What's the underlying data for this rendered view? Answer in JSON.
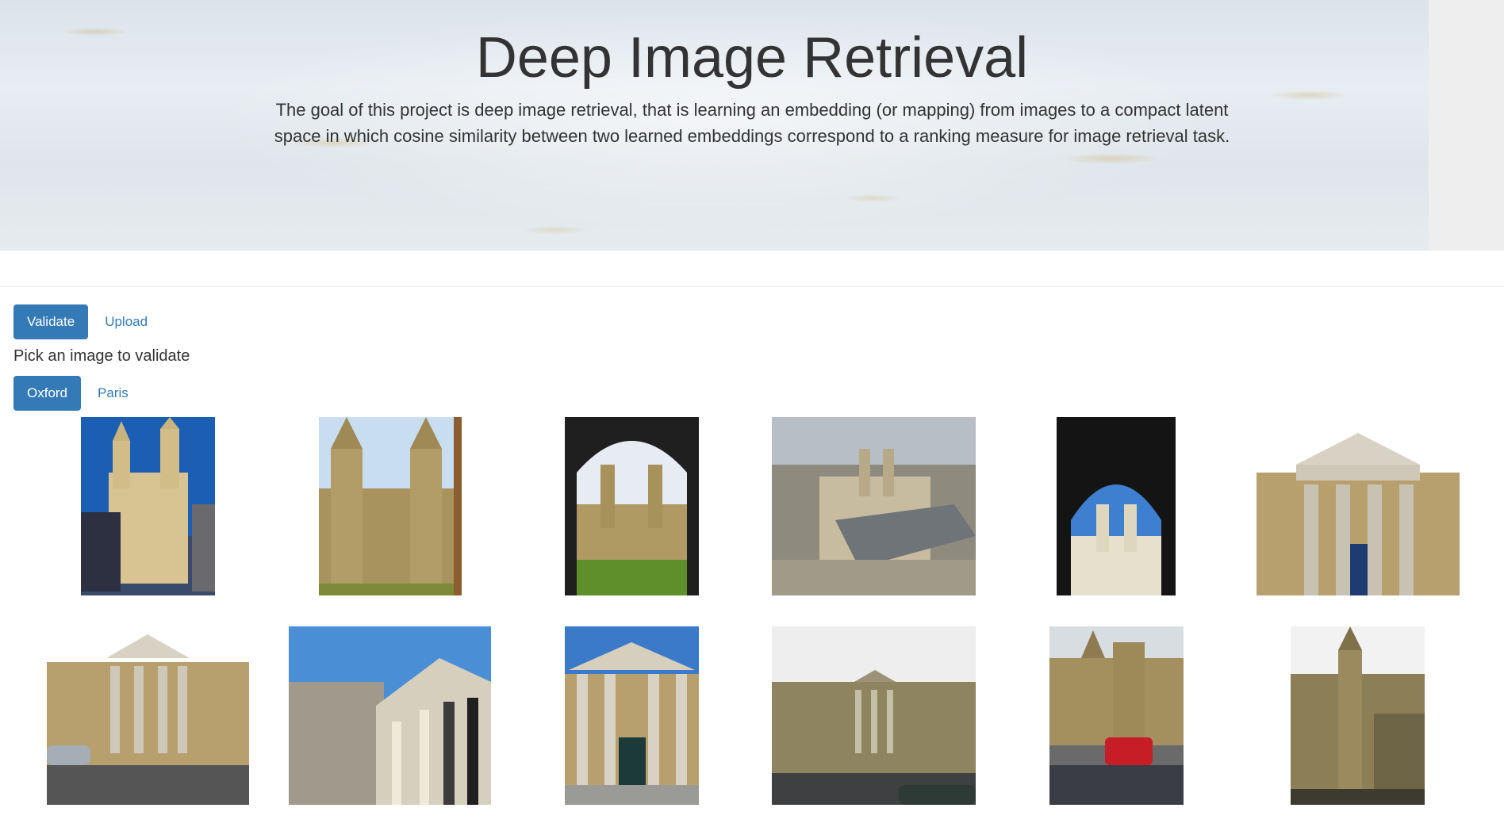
{
  "header": {
    "title": "Deep Image Retrieval",
    "description": "The goal of this project is deep image retrieval, that is learning an embedding (or mapping) from images to a compact latent space in which cosine similarity between two learned embeddings correspond to a ranking measure for image retrieval task."
  },
  "modes": [
    {
      "label": "Validate",
      "active": true
    },
    {
      "label": "Upload",
      "active": false
    }
  ],
  "instruction": "Pick an image to validate",
  "datasets": [
    {
      "label": "Oxford",
      "active": true
    },
    {
      "label": "Paris",
      "active": false
    }
  ],
  "gallery": {
    "dataset": "Oxford",
    "images": [
      {
        "subject": "all-souls-college-towers",
        "sky": "#1a5fb4"
      },
      {
        "subject": "all-souls-college-towers",
        "sky": "#c9ddf0"
      },
      {
        "subject": "all-souls-college-through-arch",
        "sky": "#e6ecf1"
      },
      {
        "subject": "all-souls-college-aerial-view",
        "sky": "#b8bec6"
      },
      {
        "subject": "all-souls-college-through-arch",
        "sky": "#3f7fd0"
      },
      {
        "subject": "ashmolean-museum-portico",
        "sky": "#ffffff"
      },
      {
        "subject": "ashmolean-museum-street-view",
        "sky": "#ffffff"
      },
      {
        "subject": "ashmolean-museum-angled-view",
        "sky": "#4a8fd6"
      },
      {
        "subject": "ashmolean-museum-portico",
        "sky": "#3b7ac8"
      },
      {
        "subject": "ashmolean-museum-overcast",
        "sky": "#eeeeee"
      },
      {
        "subject": "balliol-college-bicycles",
        "sky": "#d8dde2"
      },
      {
        "subject": "balliol-college-tower",
        "sky": "#f2f2f2"
      }
    ]
  }
}
